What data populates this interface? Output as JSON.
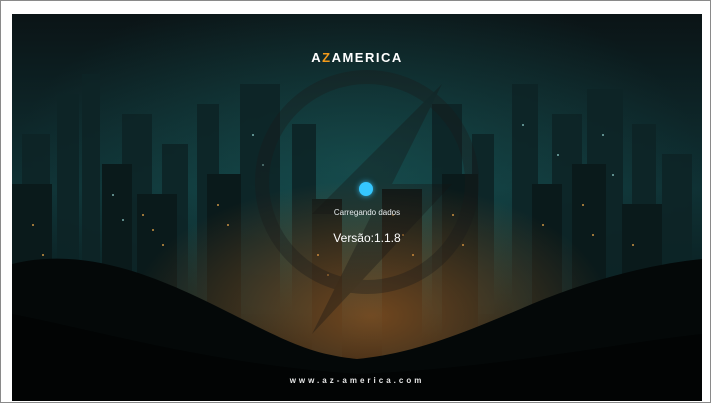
{
  "screen": {
    "brand": {
      "prefix": "A",
      "bolt": "Z",
      "suffix": "AMERICA"
    },
    "status": "Carregando dados",
    "version": "Versão:1.1.8",
    "footer_url": "www.az-america.com"
  },
  "colors": {
    "accent": "#35c7ff",
    "bolt": "#f29a1a",
    "background": "#081a1c"
  },
  "icons": {
    "logo_mark": "az-bolt-circle-logo",
    "loading_indicator": "dot-loading-icon"
  }
}
